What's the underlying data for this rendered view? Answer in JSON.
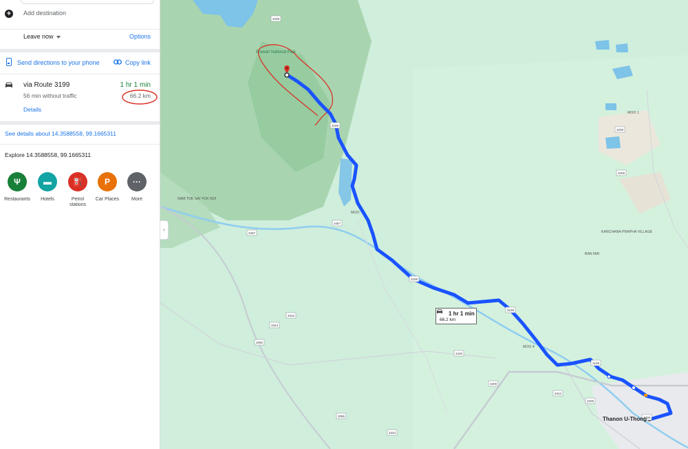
{
  "sidebar": {
    "add_destination": "Add destination",
    "leave_now": "Leave now",
    "options": "Options",
    "send_directions": "Send directions to your phone",
    "copy_link": "Copy link",
    "route": {
      "name": "via Route 3199",
      "duration": "1 hr 1 min",
      "subtitle": "56 min without traffic",
      "distance": "66.2 km",
      "details": "Details"
    },
    "see_details": "See details about 14.3588558, 99.1665311",
    "explore": "Explore 14.3588558, 99.1665311",
    "places": [
      {
        "label": "Restaurants",
        "icon": "fork-knife-icon",
        "color": "#188038",
        "glyph": "Ψ"
      },
      {
        "label": "Hotels",
        "icon": "bed-icon",
        "color": "#12a3a3",
        "glyph": "▬"
      },
      {
        "label": "Petrol stations",
        "icon": "fuel-icon",
        "color": "#d93025",
        "glyph": "⛽"
      },
      {
        "label": "Car Places",
        "icon": "parking-icon",
        "color": "#e8710a",
        "glyph": "P"
      },
      {
        "label": "More",
        "icon": "more-icon",
        "color": "#5f6368",
        "glyph": "···"
      }
    ]
  },
  "map": {
    "route_color": "#1a53ff",
    "annotation_color": "#d93025",
    "info_box": {
      "duration": "1 hr 1 min",
      "distance": "66.2 km"
    },
    "labels": {
      "erawan": "Erawan National Park",
      "nam_tok": "NAM TOK SAI YOK NOI",
      "kanchana": "KANCHANA PRAPHA VILLAGE",
      "ban_mai": "BAN MAI",
      "moo1": "MOO 1",
      "moo4": "MOO 4",
      "moo_mid": "MOO",
      "thanon": "Thanon U-Thong"
    },
    "road_shields": [
      "3199",
      "3199",
      "3457",
      "3199",
      "3199",
      "3343",
      "3343",
      "3086",
      "3209",
      "3429",
      "3086",
      "3199",
      "3343",
      "3209",
      "3457",
      "3209",
      "3209",
      "3343",
      "3209"
    ]
  }
}
